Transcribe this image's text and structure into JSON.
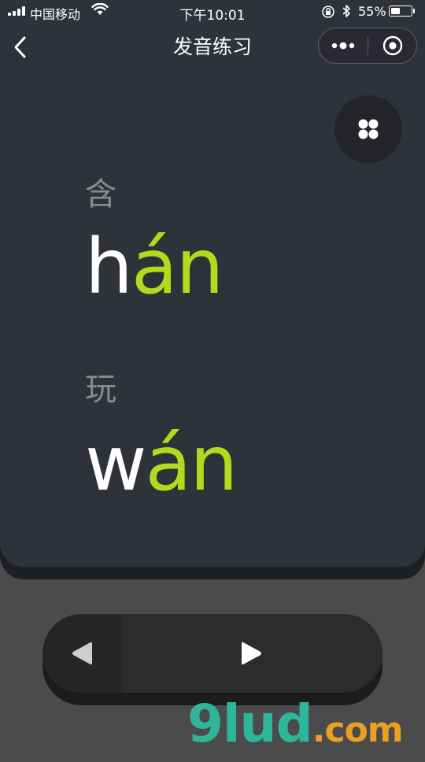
{
  "status_bar": {
    "carrier": "中国移动",
    "time": "下午10:01",
    "battery_percent": "55%",
    "battery_level": 0.55
  },
  "nav": {
    "title": "发音练习",
    "back_icon": "chevron-left-icon",
    "more_icon": "more-dots-icon",
    "close_icon": "target-circle-icon"
  },
  "menu_icon": "grid-four-icon",
  "words": [
    {
      "hanzi": "含",
      "initial": "h",
      "final": "án"
    },
    {
      "hanzi": "玩",
      "initial": "w",
      "final": "án"
    }
  ],
  "controls": {
    "prev_icon": "triangle-left-icon",
    "play_icon": "triangle-right-icon"
  },
  "watermark": {
    "main": "9lud",
    "suffix": ".com"
  },
  "colors": {
    "card": "#30323a",
    "background": "#4b4b4b",
    "accent": "#b7d81c",
    "hanzi": "#8a8b90"
  }
}
